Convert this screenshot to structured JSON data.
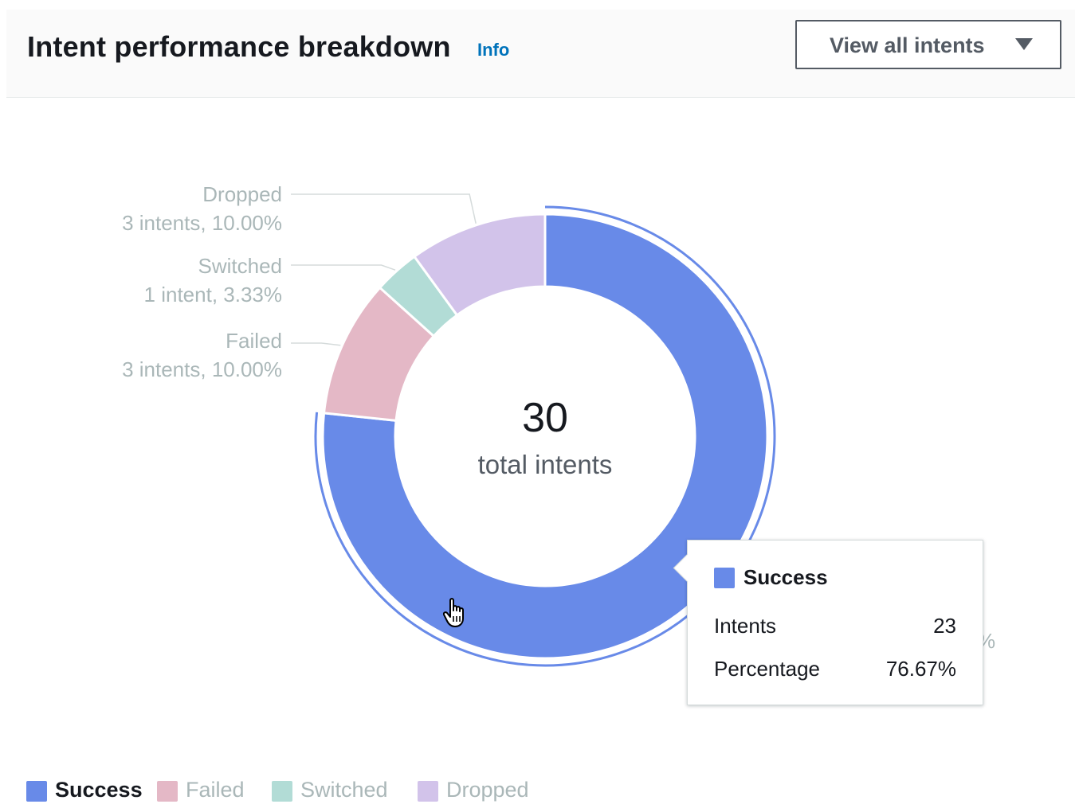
{
  "header": {
    "title": "Intent performance breakdown",
    "info_link": "Info",
    "dropdown_label": "View all intents"
  },
  "chart_data": {
    "type": "pie",
    "total": "30",
    "total_caption": "total intents",
    "series": [
      {
        "name": "Success",
        "value": 23,
        "label_line1": "",
        "label_line2": "",
        "color": "#688ae8"
      },
      {
        "name": "Failed",
        "value": 3,
        "label_line1": "Failed",
        "label_line2": "3 intents, 10.00%",
        "color": "#e4b8c6"
      },
      {
        "name": "Switched",
        "value": 1,
        "label_line1": "Switched",
        "label_line2": "1 intent, 3.33%",
        "color": "#b2dcd6"
      },
      {
        "name": "Dropped",
        "value": 3,
        "label_line1": "Dropped",
        "label_line2": "3 intents, 10.00%",
        "color": "#d2c3ea"
      }
    ],
    "highlighted": "Success",
    "occluded_label_tail": "%"
  },
  "tooltip": {
    "title": "Success",
    "rows": [
      {
        "key": "Intents",
        "value": "23"
      },
      {
        "key": "Percentage",
        "value": "76.67%"
      }
    ]
  },
  "legend": {
    "items": [
      {
        "label": "Success",
        "color": "#688ae8",
        "text_color": "#16191f",
        "bold": true
      },
      {
        "label": "Failed",
        "color": "#e4b8c6",
        "text_color": "#aab7b8",
        "bold": false
      },
      {
        "label": "Switched",
        "color": "#b2dcd6",
        "text_color": "#aab7b8",
        "bold": false
      },
      {
        "label": "Dropped",
        "color": "#d2c3ea",
        "text_color": "#aab7b8",
        "bold": false
      }
    ]
  },
  "cursor_icon": "hand-pointer-icon"
}
